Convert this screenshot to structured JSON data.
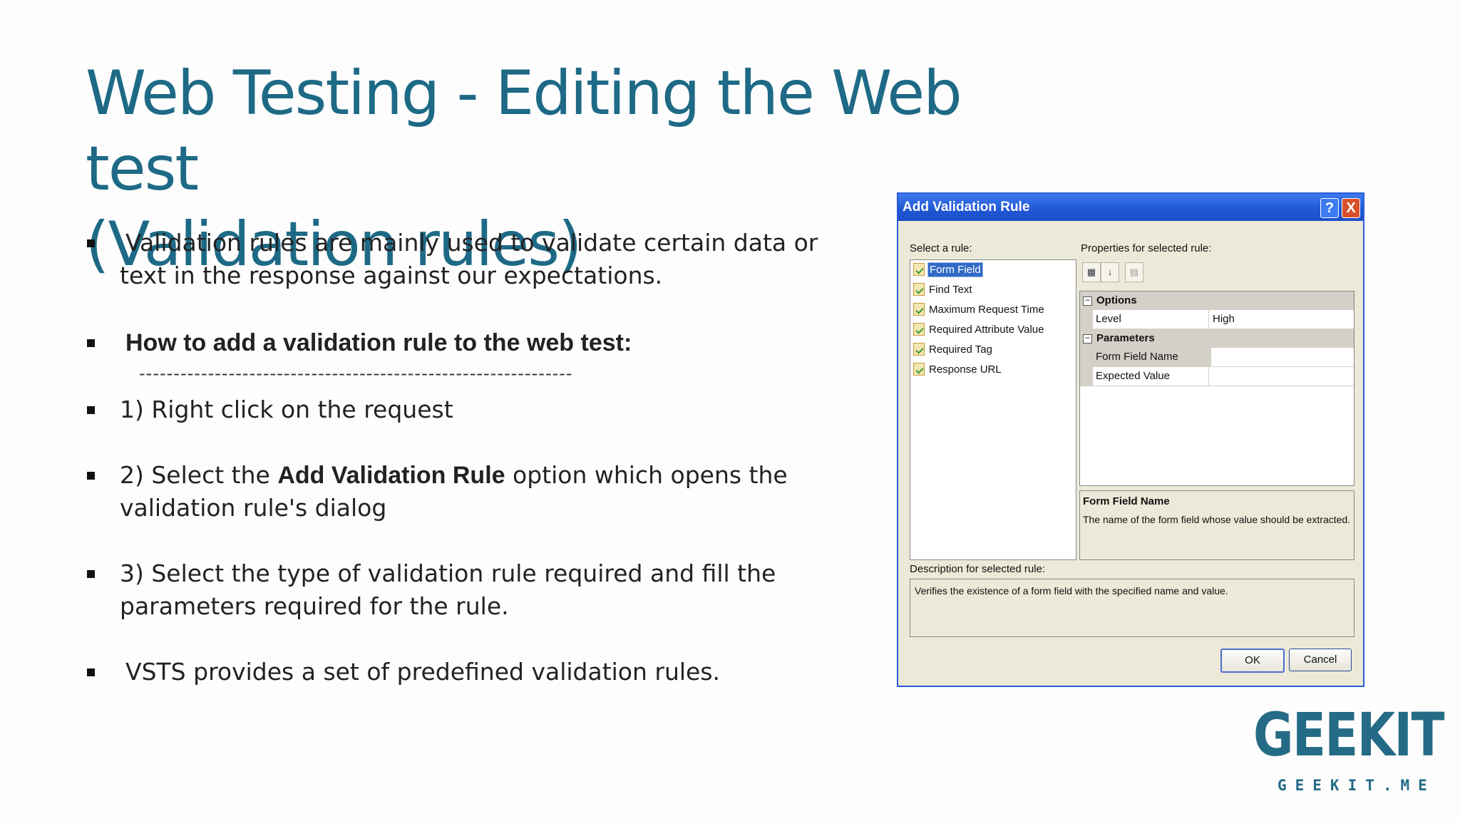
{
  "slide": {
    "title_line1": "Web Testing - Editing the Web test",
    "title_line2": "(Validation rules)",
    "bullet1": "Validation rules are mainly used to validate certain data or text in the response against our expectations.",
    "bullet2": "How to add a validation rule to the web test:",
    "dashes": "---------------------------------------------------------------",
    "bullet3": "1) Right click on the request",
    "bullet4_pre": "2) Select the ",
    "bullet4_bold": "Add Validation Rule",
    "bullet4_post": " option which opens  the validation rule's dialog",
    "bullet5": "3) Select the type of validation rule required and fill the parameters required for the rule.",
    "bullet6": "VSTS provides a set of predefined validation rules."
  },
  "dialog": {
    "title": "Add Validation Rule",
    "help": "?",
    "close": "X",
    "select_label": "Select a rule:",
    "rules": [
      "Form Field",
      "Find Text",
      "Maximum Request Time",
      "Required Attribute Value",
      "Required Tag",
      "Response URL"
    ],
    "properties_label": "Properties for selected rule:",
    "options_header": "Options",
    "level_key": "Level",
    "level_value": "High",
    "parameters_header": "Parameters",
    "param1_key": "Form Field Name",
    "param2_key": "Expected Value",
    "prop_desc_title": "Form Field Name",
    "prop_desc_text": "The name of the form field whose value should be extracted.",
    "rule_desc_label": "Description for selected rule:",
    "rule_desc_text": "Verifies the existence of a form field with the specified name and value.",
    "ok": "OK",
    "cancel": "Cancel"
  },
  "logo": {
    "main": "GEEKIT",
    "sub": "GEEKIT.ME"
  },
  "colors": {
    "title": "#1e6a86",
    "dialog_titlebar": "#1f56d3",
    "logo": "#256b86"
  },
  "icons": [
    "categorized-icon",
    "alphabetical-icon",
    "property-pages-icon",
    "rule-icon"
  ]
}
